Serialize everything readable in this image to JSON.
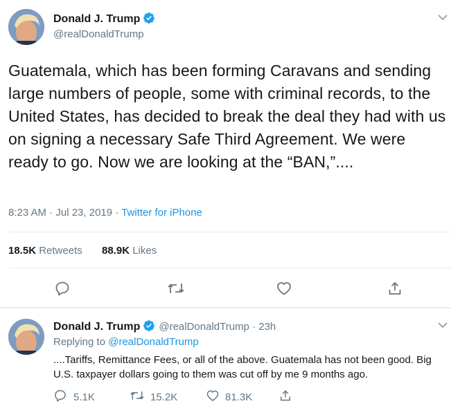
{
  "main_tweet": {
    "author_name": "Donald J. Trump",
    "handle": "@realDonaldTrump",
    "text": "Guatemala, which has been forming Caravans and sending large numbers of people, some with criminal records, to the United States, has decided to break the deal they had with us on signing a necessary Safe Third Agreement. We were ready to go. Now we are looking at the “BAN,”....",
    "time": "8:23 AM · Jul 23, 2019 · ",
    "source": "Twitter for iPhone",
    "retweets_count": "18.5K",
    "retweets_label": "Retweets",
    "likes_count": "88.9K",
    "likes_label": "Likes"
  },
  "reply_tweet": {
    "author_name": "Donald J. Trump",
    "handle_time": "@realDonaldTrump · 23h",
    "replying_prefix": "Replying to ",
    "replying_to": "@realDonaldTrump",
    "text": "....Tariffs, Remittance Fees, or all of the above. Guatemala has not been good. Big U.S. taxpayer dollars going to them was cut off by me 9 months ago.",
    "reply_count": "5.1K",
    "retweet_count": "15.2K",
    "like_count": "81.3K"
  },
  "colors": {
    "accent": "#1b95e0",
    "secondary_text": "#657786",
    "divider": "#e6ecf0"
  },
  "icons": [
    "verified-badge-icon",
    "chevron-down-icon",
    "reply-icon",
    "retweet-icon",
    "like-icon",
    "share-icon"
  ]
}
